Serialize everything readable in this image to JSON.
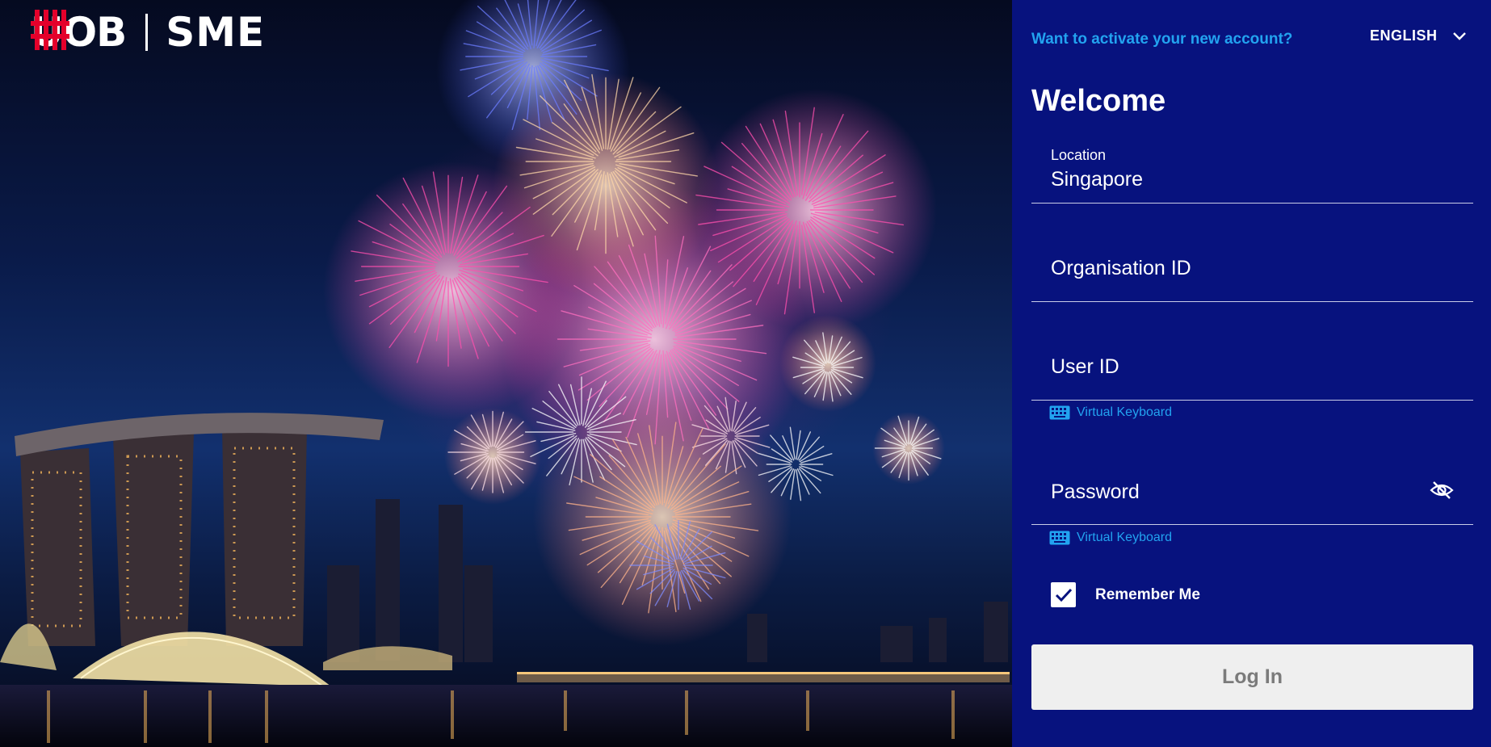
{
  "brand": {
    "logo_text": "UOB",
    "product": "SME",
    "brand_red": "#e4002b"
  },
  "panel": {
    "activate_link": "Want to activate your new account?",
    "language": "ENGLISH",
    "welcome": "Welcome",
    "background_color": "#07127e",
    "accent_color": "#22a3f0"
  },
  "form": {
    "location_label": "Location",
    "location_value": "Singapore",
    "organisation_id_placeholder": "Organisation ID",
    "user_id_placeholder": "User ID",
    "password_placeholder": "Password",
    "virtual_keyboard_label": "Virtual Keyboard",
    "remember_me_label": "Remember Me",
    "remember_me_checked": true,
    "login_button": "Log In"
  },
  "icons": {
    "language_chevron": "chevron-down-icon",
    "virtual_keyboard": "keyboard-icon",
    "password_visibility": "eye-off-icon",
    "remember_checkbox": "checkmark-icon"
  }
}
